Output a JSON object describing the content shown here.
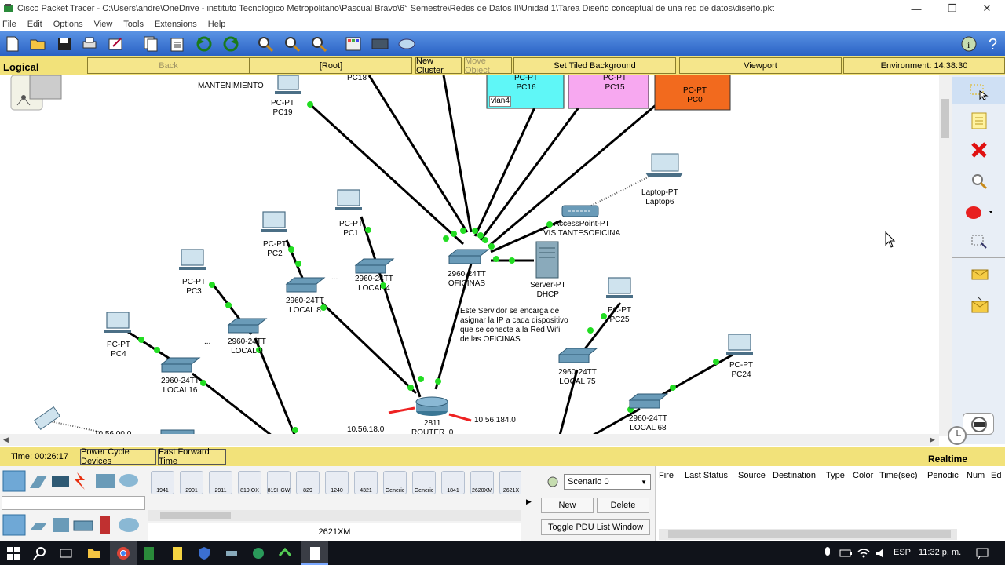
{
  "window": {
    "title": "Cisco Packet Tracer - C:\\Users\\andre\\OneDrive - instituto Tecnologico Metropolitano\\Pascual Bravo\\6° Semestre\\Redes de Datos II\\Unidad 1\\Tarea Diseño conceptual de una red de datos\\diseño.pkt"
  },
  "menu": [
    "File",
    "Edit",
    "Options",
    "View",
    "Tools",
    "Extensions",
    "Help"
  ],
  "logical_bar": {
    "label": "Logical",
    "back": "Back",
    "root": "[Root]",
    "new_cluster": "New Cluster",
    "move_object": "Move Object",
    "tiled_bg": "Set Tiled Background",
    "viewport": "Viewport",
    "environment": "Environment: 14:38:30"
  },
  "canvas": {
    "labels": {
      "mantenimiento": "MANTENIMIENTO",
      "pc19": "PC-PT\nPC19",
      "pc18": "PC18",
      "pc16": "PC-PT\nPC16",
      "pc15": "PC-PT\nPC15",
      "pc0": "PC-PT\nPC0",
      "vlan4": "vlan4",
      "laptop6": "Laptop-PT\nLaptop6",
      "ap": "AccessPoint-PT\nVISITANTESOFICINA",
      "pc1": "PC-PT\nPC1",
      "pc2": "PC-PT\nPC2",
      "pc3": "PC-PT\nPC3",
      "pc4": "PC-PT\nPC4",
      "sw_oficinas": "2960-24TT\nOFICINAS",
      "server": "Server-PT\nDHCP",
      "sw_local4": "2960-24TT\nLOCAL 4",
      "sw_local8": "2960-24TT\nLOCAL 8",
      "sw_local9": "2960-24TT\nLOCAL 9",
      "sw_local16": "2960-24TT\nLOCAL16",
      "pc25": "PC-PT\nPC25",
      "pc24": "PC-PT\nPC24",
      "sw_local75": "2960-24TT\nLOCAL 75",
      "sw_local68": "2960-24TT\nLOCAL 68",
      "router": "2811\nROUTER_0",
      "ip_left": "10.56.18.0",
      "ip_right": "10.56.184.0",
      "ip_bl": "10.56.00.0",
      "dots1": "...",
      "dots2": "..."
    },
    "note": "Este Servidor se encarga de\nasignar la IP a cada dispositivo\nque se conecte a la Red Wifi\nde las OFICINAS"
  },
  "status": {
    "time": "Time: 00:26:17",
    "power_cycle": "Power Cycle Devices",
    "fast_forward": "Fast Forward Time",
    "mode": "Realtime"
  },
  "devices": {
    "models": [
      "1941",
      "2901",
      "2911",
      "819IOX",
      "819HGW",
      "829",
      "1240",
      "4321",
      "Generic",
      "Generic",
      "1841",
      "2620XM",
      "2621X"
    ],
    "selected": "2621XM"
  },
  "scenario": {
    "value": "Scenario 0",
    "new": "New",
    "delete": "Delete",
    "toggle": "Toggle PDU List Window"
  },
  "pdu_columns": [
    "Fire",
    "Last Status",
    "Source",
    "Destination",
    "Type",
    "Color",
    "Time(sec)",
    "Periodic",
    "Num",
    "Ed"
  ],
  "taskbar": {
    "lang": "ESP",
    "clock": "11:32 p. m."
  },
  "colors": {
    "toolbar": "#2a62c4",
    "yellow_bar": "#f2e27a",
    "link_green": "#22dd22",
    "cyan": "#5ff7f7",
    "pink": "#f7a8f0",
    "orange": "#f26a1e"
  }
}
